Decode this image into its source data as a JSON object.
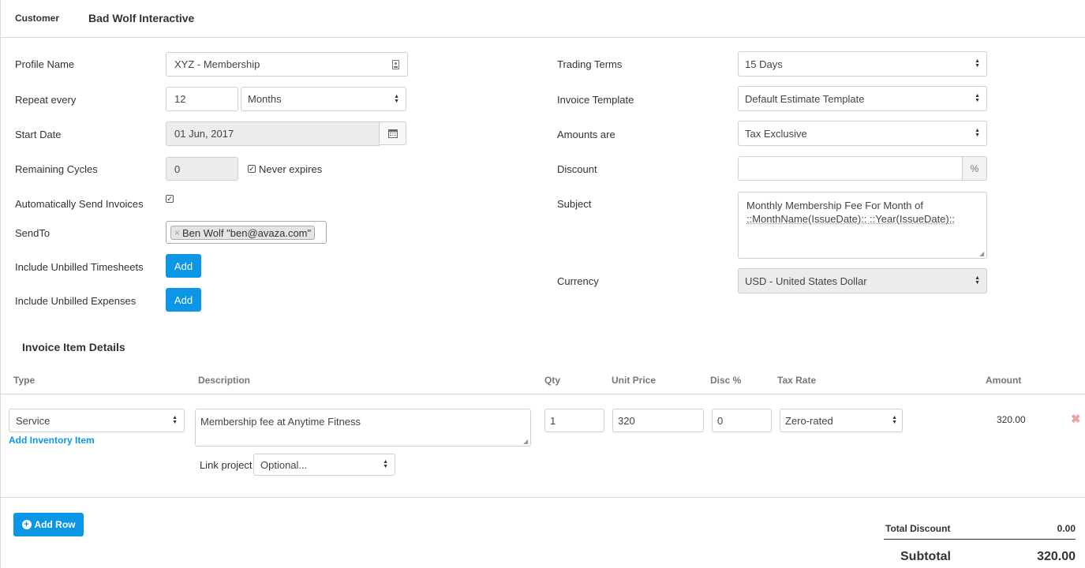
{
  "header": {
    "customer_label": "Customer",
    "customer_value": "Bad Wolf Interactive"
  },
  "left": {
    "profile_name": {
      "label": "Profile Name",
      "value": "XYZ - Membership"
    },
    "repeat_every": {
      "label": "Repeat every",
      "value": "12",
      "unit": "Months"
    },
    "start_date": {
      "label": "Start Date",
      "value": "01 Jun, 2017"
    },
    "remaining_cycles": {
      "label": "Remaining Cycles",
      "value": "0",
      "never_expires_label": "Never expires",
      "never_expires_checked": true
    },
    "auto_send": {
      "label": "Automatically Send Invoices",
      "checked": true
    },
    "send_to": {
      "label": "SendTo",
      "tags": [
        "Ben Wolf \"ben@avaza.com\""
      ]
    },
    "unbilled_timesheets": {
      "label": "Include Unbilled Timesheets",
      "button": "Add"
    },
    "unbilled_expenses": {
      "label": "Include Unbilled Expenses",
      "button": "Add"
    }
  },
  "right": {
    "trading_terms": {
      "label": "Trading Terms",
      "value": "15 Days"
    },
    "invoice_template": {
      "label": "Invoice Template",
      "value": "Default Estimate Template"
    },
    "amounts_are": {
      "label": "Amounts are",
      "value": "Tax Exclusive"
    },
    "discount": {
      "label": "Discount",
      "value": "",
      "suffix": "%"
    },
    "subject": {
      "label": "Subject",
      "line1": "Monthly Membership Fee For Month of",
      "line2": "::MonthName(IssueDate):: ::Year(IssueDate)::"
    },
    "currency": {
      "label": "Currency",
      "value": "USD - United States Dollar"
    }
  },
  "items": {
    "title": "Invoice Item Details",
    "headers": {
      "type": "Type",
      "description": "Description",
      "qty": "Qty",
      "unit_price": "Unit Price",
      "disc": "Disc %",
      "tax_rate": "Tax Rate",
      "amount": "Amount"
    },
    "row": {
      "type": "Service",
      "add_inventory": "Add Inventory Item",
      "description": "Membership fee at Anytime Fitness",
      "link_project_label": "Link project",
      "link_project_value": "Optional...",
      "qty": "1",
      "unit_price": "320",
      "disc": "0",
      "tax_rate": "Zero-rated",
      "amount": "320.00"
    },
    "add_row": "Add Row"
  },
  "totals": {
    "total_discount_label": "Total Discount",
    "total_discount_value": "0.00",
    "subtotal_label": "Subtotal",
    "subtotal_value": "320.00"
  },
  "colors": {
    "accent": "#0c97e6",
    "border": "#cfcfcf",
    "disabled_bg": "#ececec",
    "remove": "#f0a0a0"
  }
}
